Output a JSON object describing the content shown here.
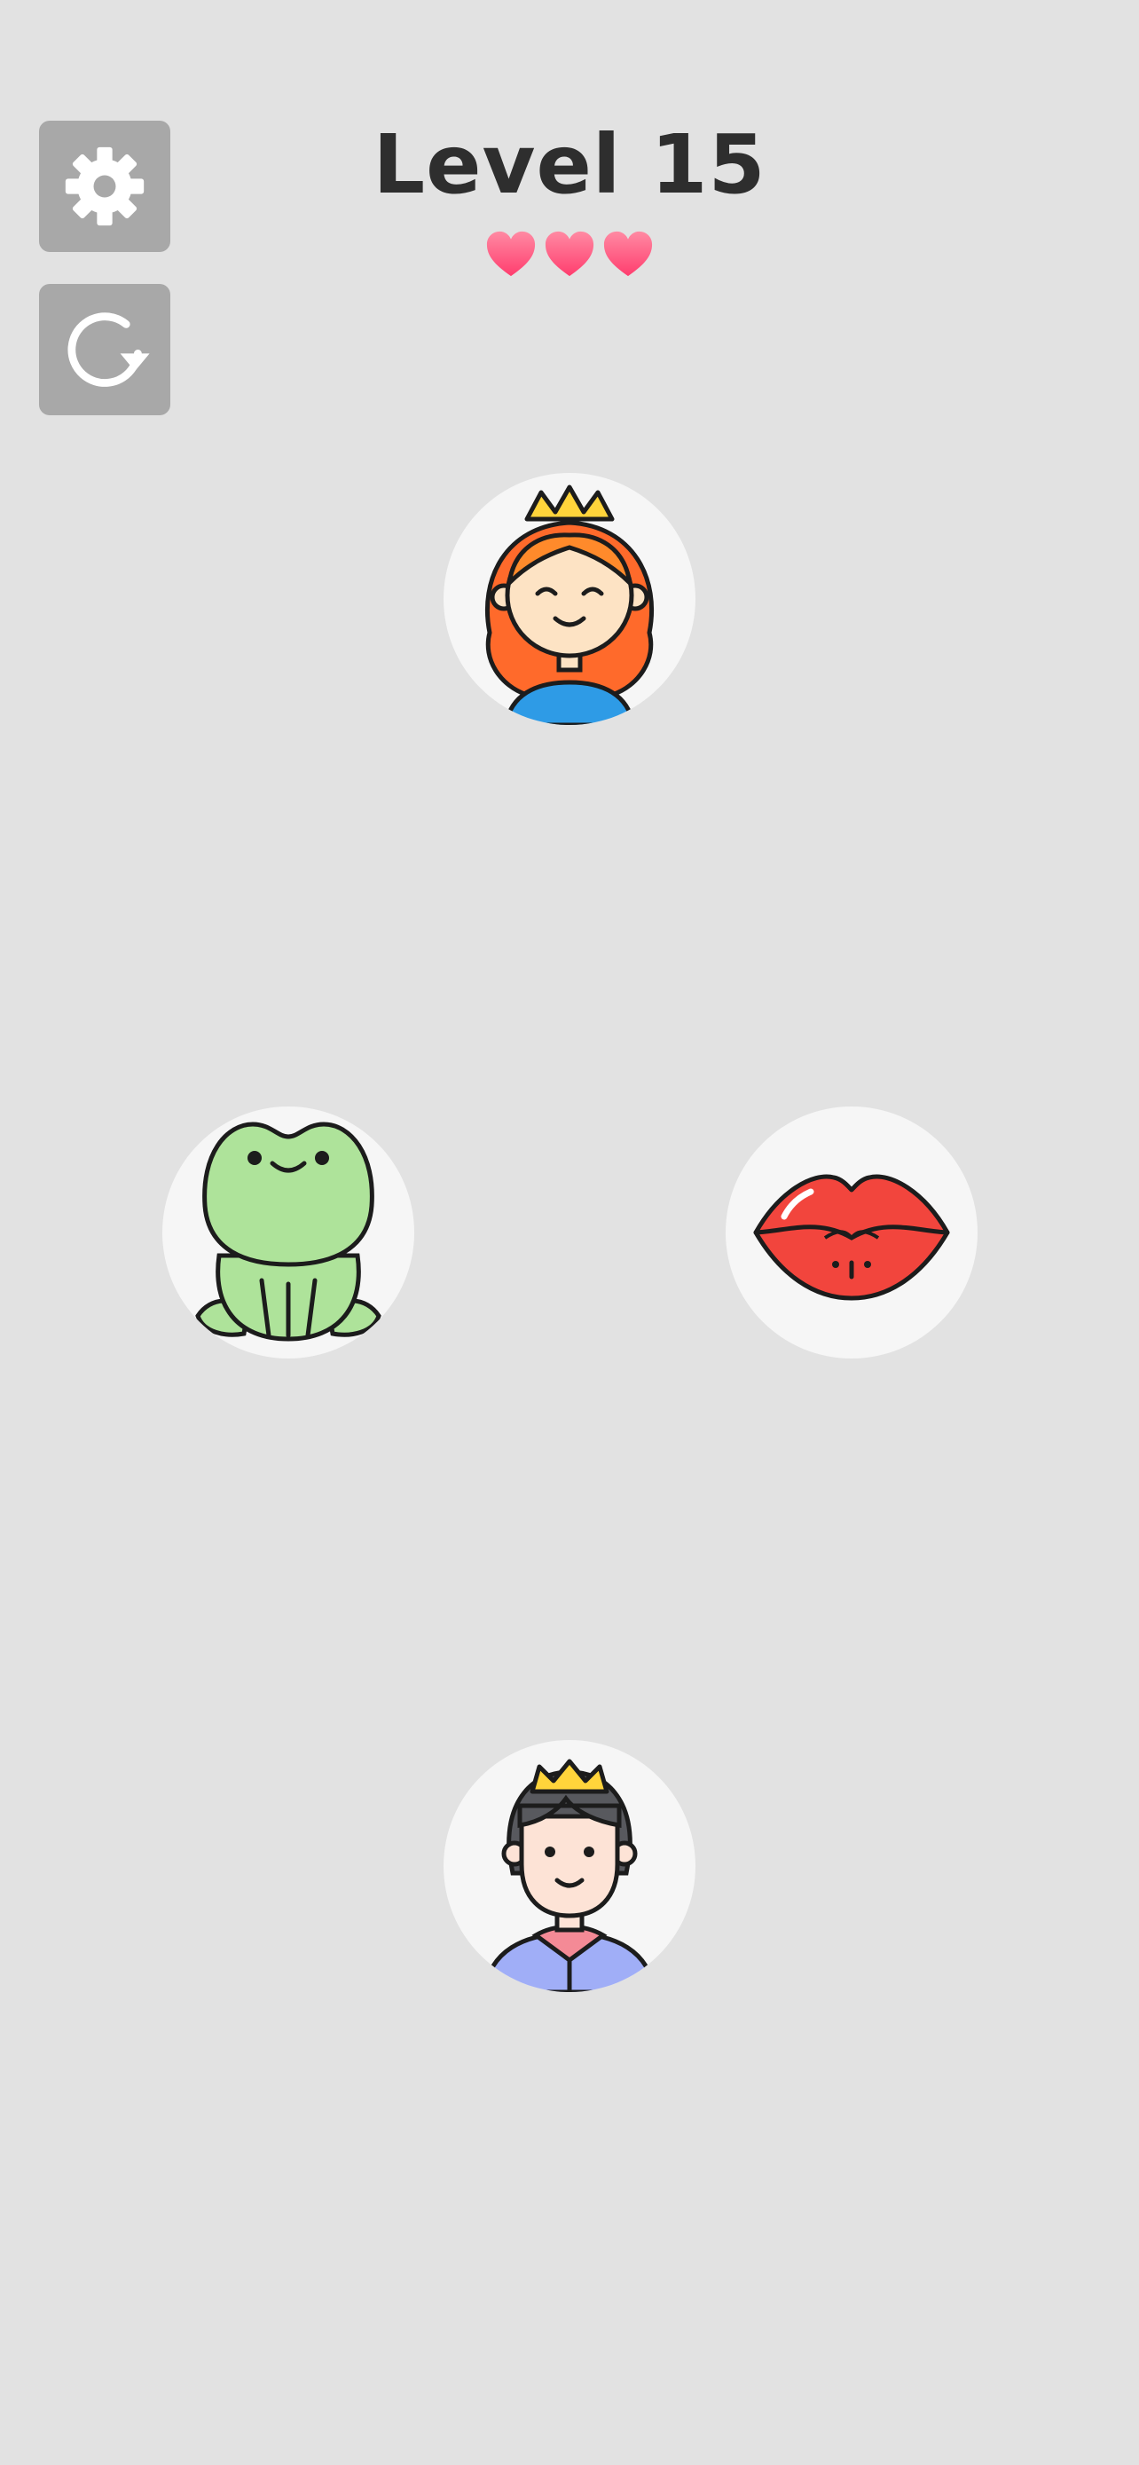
{
  "header": {
    "title": "Level 15",
    "lives": 3,
    "heart_color": "#ff4d7d"
  },
  "controls": {
    "settings_icon": "gear-icon",
    "restart_icon": "restart-icon",
    "button_color": "#a8a8a8"
  },
  "board": {
    "tiles": [
      {
        "id": "princess",
        "icon": "princess-icon"
      },
      {
        "id": "frog",
        "icon": "frog-icon"
      },
      {
        "id": "lips",
        "icon": "lips-icon"
      },
      {
        "id": "prince",
        "icon": "prince-icon"
      }
    ]
  },
  "colors": {
    "background": "#e2e2e2",
    "tile": "#f6f6f6",
    "title": "#2e2e2e"
  }
}
